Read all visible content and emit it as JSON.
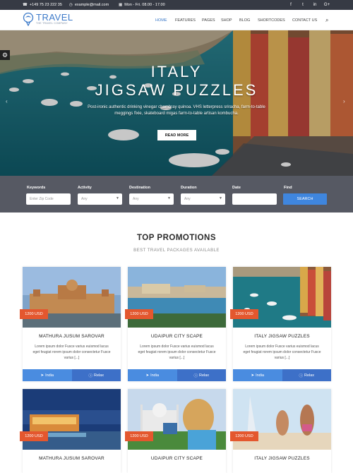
{
  "topbar": {
    "phone": "+149 75 23 222 35",
    "email": "example@mail.com",
    "hours": "Mon - Fri. 08.00 - 17.00",
    "social": [
      "f",
      "t",
      "in",
      "G+"
    ]
  },
  "header": {
    "logo_main": "TRAVEL",
    "logo_sub": "THE TRAVEL COMPANY",
    "nav": [
      "HOME",
      "FEATURES",
      "PAGES",
      "SHOP",
      "BLOG",
      "SHORTCODES",
      "CONTACT US"
    ]
  },
  "hero": {
    "title_line1": "ITALY",
    "title_line2": "JIGSAW PUZZLES",
    "text": "Post-ironic authentic drinking vinegar chambray quinoa. VHS letterpress sriracha, farm-to-table meggings fixie, skateboard migas farm-to-table artisan kombucha.",
    "button": "READ MORE"
  },
  "search": {
    "keywords_label": "Keywords",
    "keywords_placeholder": "Enter Zip Code",
    "activity_label": "Activity",
    "activity_value": "Any",
    "destination_label": "Destination",
    "destination_value": "Any",
    "duration_label": "Duration",
    "duration_value": "Any",
    "date_label": "Date",
    "find_label": "Find",
    "button": "SEARCH"
  },
  "promotions": {
    "title": "TOP PROMOTIONS",
    "subtitle": "BEST TRAVEL PACKAGES AVAILABLE",
    "cards": [
      {
        "price": "1200 USD",
        "title": "MATHURA JUSUM SAROVAR",
        "desc": "Lorem ipsum dolor Fusce varius euismod lacus eget feugiat rorem ipsum dolor consectetur Fusce varius [...]",
        "left": "India",
        "right": "Relax"
      },
      {
        "price": "1200 USD",
        "title": "UDAIPUR CITY SCAPE",
        "desc": "Lorem ipsum dolor Fusce varius euismod lacus eget feugiat rorem ipsum dolor consectetur Fusce varius [...]",
        "left": "India",
        "right": "Relax"
      },
      {
        "price": "1200 USD",
        "title": "ITALY JIGSAW PUZZLES",
        "desc": "Lorem ipsum dolor Fusce varius euismod lacus eget feugiat rorem ipsum dolor consectetur Fusce varius [...]",
        "left": "India",
        "right": "Relax"
      },
      {
        "price": "1200 USD",
        "title": "MATHURA JUSUM SAROVAR"
      },
      {
        "price": "1200 USD",
        "title": "UDAIPUR CITY SCAPE"
      },
      {
        "price": "1200 USD",
        "title": "ITALY JIGSAW PUZZLES"
      }
    ]
  }
}
